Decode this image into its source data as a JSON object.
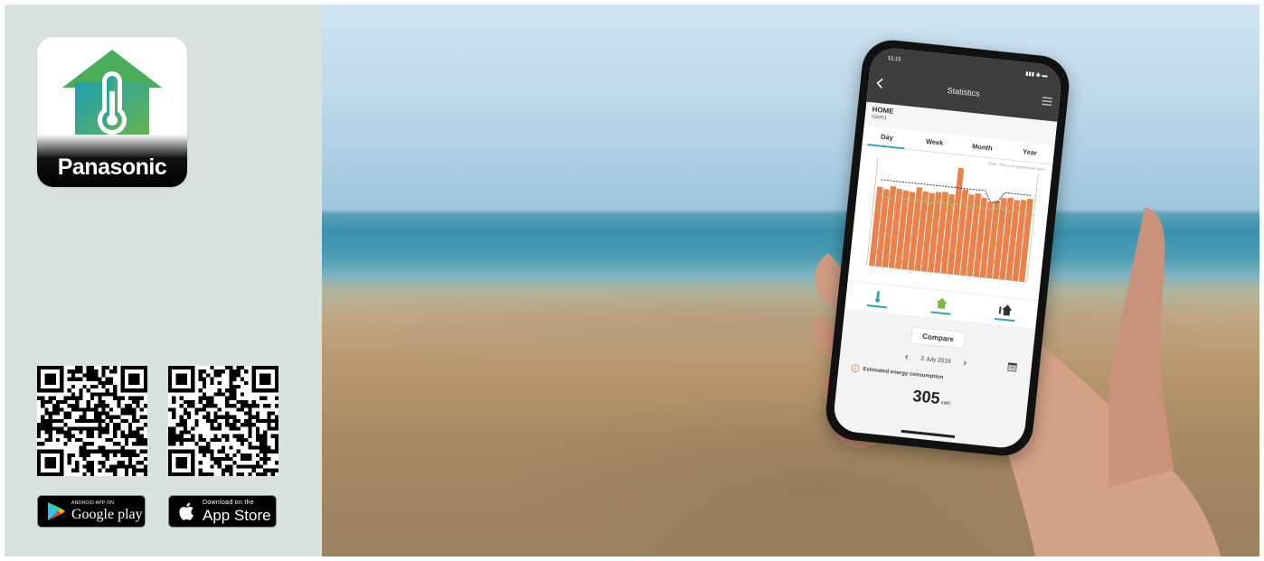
{
  "left": {
    "brand": "Panasonic",
    "google_badge": {
      "small": "ANDROID APP ON",
      "big": "Google play"
    },
    "apple_badge": {
      "small": "Download on the",
      "big": "App Store"
    }
  },
  "phone": {
    "status_time": "15:15",
    "screen_title": "Statistics",
    "home_label": "HOME",
    "room_label": "room1",
    "tabs": [
      {
        "label": "Day",
        "active": true
      },
      {
        "label": "Week",
        "active": false
      },
      {
        "label": "Month",
        "active": false
      },
      {
        "label": "Year",
        "active": false
      }
    ],
    "chart_note": "Note : This is an approximate value",
    "compare_label": "Compare",
    "date_label": "2 July 2019",
    "estimate_label": "Estimated energy consumption",
    "value": "305",
    "unit": "kWh"
  },
  "colors": {
    "panel_bg": "#d6e3de",
    "accent": "#35a0b9",
    "bar": "#e8814a",
    "icon_green": "#7dba3c",
    "icon_gradient_start": "#1d9fb5",
    "icon_gradient_end": "#6ab54a",
    "house_roof": "#4aad5a"
  },
  "icons": [
    "house-thermometer-icon",
    "back-icon",
    "menu-icon",
    "thermometer-icon",
    "home-icon",
    "outdoor-temp-icon",
    "calendar-icon",
    "info-icon",
    "apple-icon",
    "google-play-icon"
  ]
}
